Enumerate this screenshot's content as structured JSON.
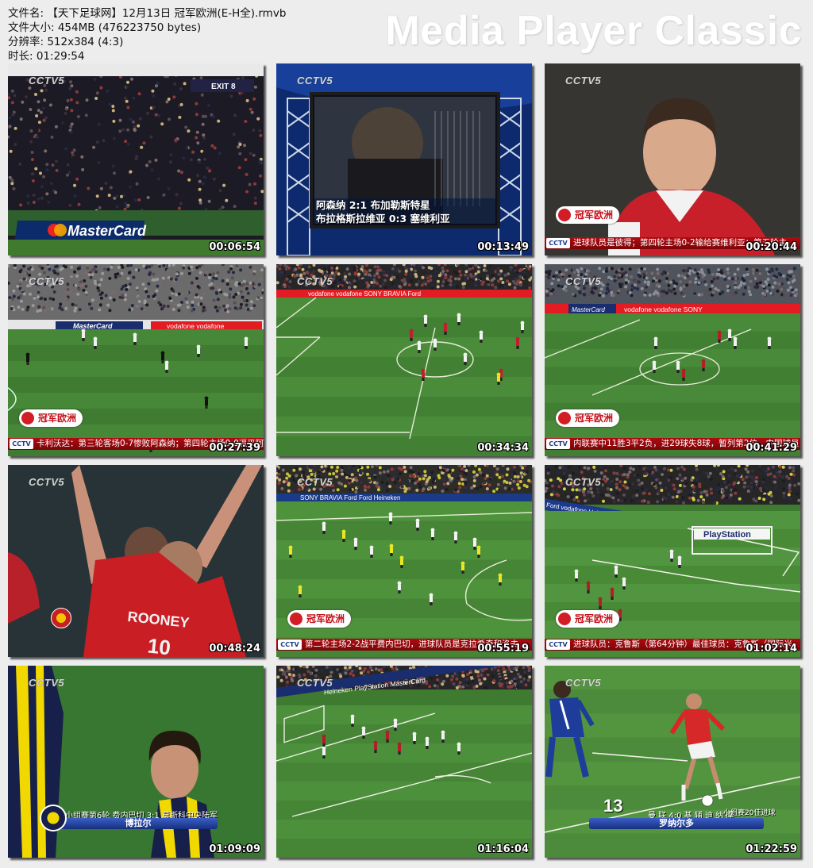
{
  "info": {
    "filename": "文件名: 【天下足球网】12月13日 冠军欧洲(E-H全).rmvb",
    "filesize": "文件大小: 454MB (476223750 bytes)",
    "resolution": "分辨率: 512x384 (4:3)",
    "duration": "时长: 01:29:54"
  },
  "brand": "Media Player Classic",
  "channel_logo": "CCTV5",
  "thumbnails": [
    {
      "time": "00:06:54",
      "scene": "crowd",
      "texts": {
        "board": "MasterCard",
        "exit": "EXIT 8"
      }
    },
    {
      "time": "00:13:49",
      "scene": "studio",
      "texts": {
        "line1": "阿森纳 2:1 布加勒斯特星",
        "line2": "布拉格斯拉维亚 0:3 塞维利亚"
      }
    },
    {
      "time": "00:20:44",
      "scene": "player-closeup",
      "texts": {
        "badge": "冠军欧洲",
        "ticker": "进球队员是彼得；第四轮主场0-2输给赛维利亚；第五轮主"
      }
    },
    {
      "time": "00:27:39",
      "scene": "pitch-a",
      "texts": {
        "badge": "冠军欧洲",
        "ticker": "卡利沃达：第三轮客场0-7惨败阿森纳；第四轮主场0-0逼平阿"
      }
    },
    {
      "time": "00:34:34",
      "scene": "pitch-b",
      "texts": {}
    },
    {
      "time": "00:41:29",
      "scene": "pitch-c",
      "texts": {
        "badge": "冠军欧洲",
        "ticker": "内联赛中11胜3平2负，进29球失8球，暂列第2位。中国球员"
      }
    },
    {
      "time": "00:48:24",
      "scene": "celebration",
      "texts": {
        "name": "ROONEY",
        "number": "10"
      }
    },
    {
      "time": "00:55:19",
      "scene": "pitch-d",
      "texts": {
        "badge": "冠军欧洲",
        "ticker": "第二轮主场2-2战平费内巴切，进球队员是克拉希奇和洛夫"
      }
    },
    {
      "time": "01:02:14",
      "scene": "pitch-e",
      "texts": {
        "badge": "冠军欧洲",
        "ticker": "进球队员：克鲁斯（第64分钟）最佳球员：克鲁斯（国际米"
      }
    },
    {
      "time": "01:09:09",
      "scene": "fener",
      "texts": {
        "lower1": "小组赛第6轮  费内巴切 3:1 莫斯科中央陆军",
        "lower2": "博拉尔"
      }
    },
    {
      "time": "01:16:04",
      "scene": "pitch-f",
      "texts": {}
    },
    {
      "time": "01:22:59",
      "scene": "ronaldo",
      "texts": {
        "num": "13",
        "lower0": "小组赛20佳进球",
        "lower1": "曼 联 4:0 基 辅 迪 纳 摩",
        "lower2": "罗纳尔多"
      }
    }
  ]
}
